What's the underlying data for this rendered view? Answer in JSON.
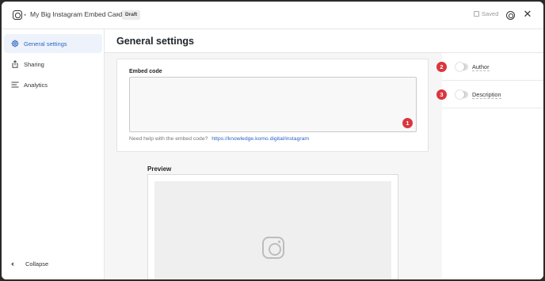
{
  "header": {
    "breadcrumb_title": "My Big Instagram Embed Card",
    "status_badge": "Draft",
    "saved_label": "Saved",
    "close_glyph": "✕"
  },
  "sidebar": {
    "items": [
      {
        "label": "General settings",
        "icon": "gear-icon",
        "active": true
      },
      {
        "label": "Sharing",
        "icon": "share-icon",
        "active": false
      },
      {
        "label": "Analytics",
        "icon": "analytics-icon",
        "active": false
      }
    ],
    "collapse_label": "Collapse"
  },
  "main": {
    "page_title": "General settings",
    "embed": {
      "label": "Embed code",
      "value": "",
      "help_text": "Need help with the embed code?",
      "help_link": "https://knowledge.komo.digital/instagram"
    },
    "preview": {
      "label": "Preview"
    }
  },
  "right_panel": {
    "toggles": [
      {
        "label": "Author",
        "on": false
      },
      {
        "label": "Description",
        "on": false
      }
    ]
  },
  "markers": [
    "1",
    "2",
    "3"
  ],
  "colors": {
    "accent": "#2c64c6",
    "marker": "#d9363e",
    "active_bg": "#eef3fb"
  }
}
